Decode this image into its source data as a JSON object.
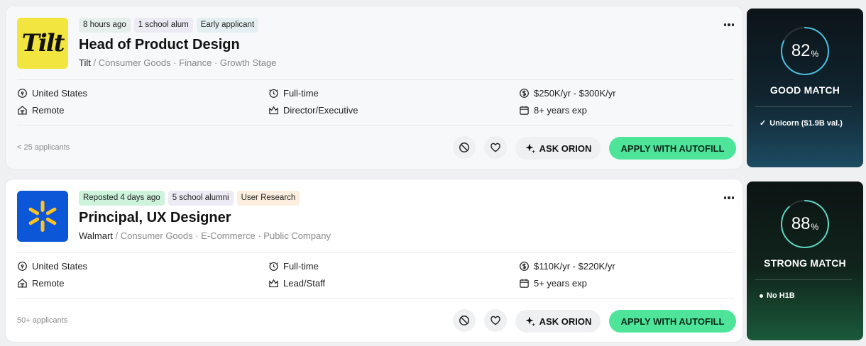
{
  "jobs": [
    {
      "logo_text": "Tilt",
      "logo_bg": "#f2e53f",
      "tags": [
        {
          "label": "8 hours ago",
          "bg": "#e6efec"
        },
        {
          "label": "1 school alum",
          "bg": "#eceaf3"
        },
        {
          "label": "Early applicant",
          "bg": "#e4eff1"
        }
      ],
      "title": "Head of Product Design",
      "company": "Tilt",
      "meta": " / Consumer Goods · Finance · Growth Stage",
      "location": "United States",
      "work_mode": "Remote",
      "job_type": "Full-time",
      "level": "Director/Executive",
      "salary": "$250K/yr - $300K/yr",
      "experience": "8+ years exp",
      "applicants": "< 25 applicants",
      "ask_label": "ASK ORION",
      "apply_label": "APPLY WITH AUTOFILL",
      "match": {
        "percent": 82,
        "percent_text": "82",
        "percent_symbol": "%",
        "label": "GOOD MATCH",
        "note_icon": "check-icon",
        "note_mark": "✓",
        "note": "Unicorn ($1.9B val.)",
        "ring_color": "#4bbfe0"
      }
    },
    {
      "logo_icon": "walmart-spark-icon",
      "logo_bg": "#0c56d8",
      "tags": [
        {
          "label": "Reposted 4 days ago",
          "bg": "#cdf3dc"
        },
        {
          "label": "5 school alumni",
          "bg": "#eceaf3"
        },
        {
          "label": "User Research",
          "bg": "#fcefdf"
        }
      ],
      "title": "Principal, UX Designer",
      "company": "Walmart",
      "meta": " / Consumer Goods · E-Commerce · Public Company",
      "location": "United States",
      "work_mode": "Remote",
      "job_type": "Full-time",
      "level": "Lead/Staff",
      "salary": "$110K/yr - $220K/yr",
      "experience": "5+ years exp",
      "applicants": "50+ applicants",
      "ask_label": "ASK ORION",
      "apply_label": "APPLY WITH AUTOFILL",
      "match": {
        "percent": 88,
        "percent_text": "88",
        "percent_symbol": "%",
        "label": "STRONG MATCH",
        "note_icon": "dot-icon",
        "note": "No H1B",
        "ring_color": "#5fd6c4"
      }
    }
  ]
}
